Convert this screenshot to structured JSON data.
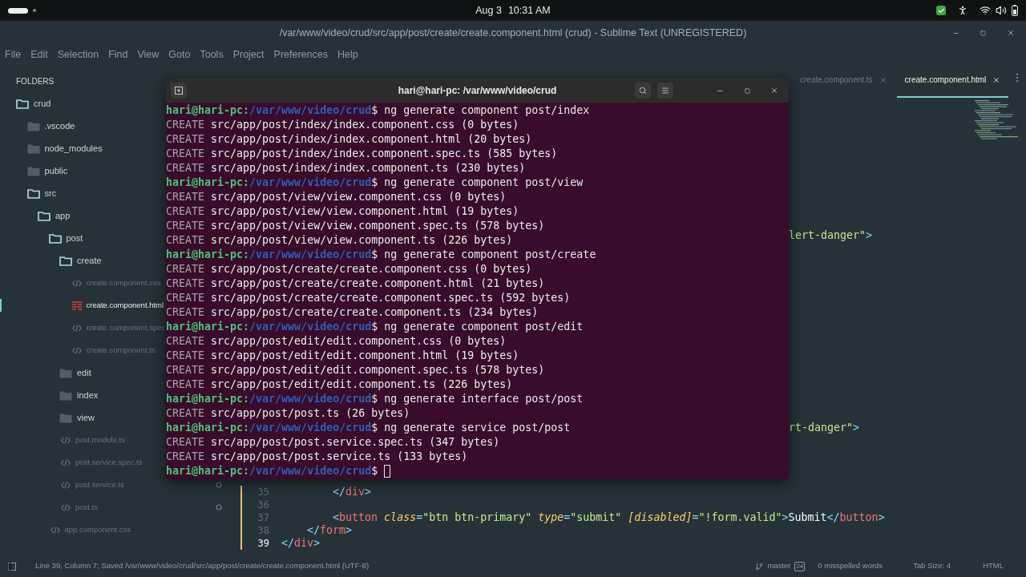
{
  "top_bar": {
    "date": "Aug 3",
    "time": "10:31 AM"
  },
  "window": {
    "title": "/var/www/video/crud/src/app/post/create/create.component.html (crud) - Sublime Text (UNREGISTERED)"
  },
  "menu": [
    "File",
    "Edit",
    "Selection",
    "Find",
    "View",
    "Goto",
    "Tools",
    "Project",
    "Preferences",
    "Help"
  ],
  "sidebar": {
    "header": "FOLDERS",
    "items": [
      {
        "label": "crud",
        "kind": "folder",
        "expanded": true,
        "children": [
          {
            "label": ".vscode",
            "kind": "folder",
            "expanded": false
          },
          {
            "label": "node_modules",
            "kind": "folder",
            "expanded": false
          },
          {
            "label": "public",
            "kind": "folder",
            "expanded": false
          },
          {
            "label": "src",
            "kind": "folder",
            "expanded": true,
            "children": [
              {
                "label": "app",
                "kind": "folder",
                "expanded": true,
                "children": [
                  {
                    "label": "post",
                    "kind": "folder",
                    "expanded": true,
                    "children": [
                      {
                        "label": "create",
                        "kind": "folder",
                        "expanded": true,
                        "children": [
                          {
                            "label": "create.component.css",
                            "kind": "file",
                            "selected": false
                          },
                          {
                            "label": "create.component.html",
                            "kind": "file",
                            "selected": true
                          },
                          {
                            "label": "create.component.spec",
                            "kind": "file",
                            "selected": false
                          },
                          {
                            "label": "create.component.ts",
                            "kind": "file",
                            "selected": false
                          }
                        ]
                      },
                      {
                        "label": "edit",
                        "kind": "folder",
                        "expanded": false
                      },
                      {
                        "label": "index",
                        "kind": "folder",
                        "expanded": false
                      },
                      {
                        "label": "view",
                        "kind": "folder",
                        "expanded": false
                      },
                      {
                        "label": "post.module.ts",
                        "kind": "file",
                        "selected": false
                      },
                      {
                        "label": "post.service.spec.ts",
                        "kind": "file",
                        "selected": false
                      },
                      {
                        "label": "post.service.ts",
                        "kind": "file",
                        "selected": false,
                        "modified": true
                      },
                      {
                        "label": "post.ts",
                        "kind": "file",
                        "selected": false,
                        "modified": true
                      }
                    ]
                  },
                  {
                    "label": "app.component.css",
                    "kind": "file",
                    "selected": false
                  }
                ]
              }
            ]
          }
        ]
      }
    ]
  },
  "tabs": [
    {
      "label": "create.component.ts",
      "selected": false
    },
    {
      "label": "create.component.html",
      "selected": true
    }
  ],
  "editor": {
    "fragments": [
      [
        {
          "kind": "string",
          "text": "lert-danger\""
        },
        {
          "kind": "punct",
          "text": ">"
        }
      ],
      [
        {
          "kind": "string",
          "text": "rt-danger\""
        },
        {
          "kind": "punct",
          "text": ">"
        }
      ]
    ],
    "lines": [
      {
        "number": "35",
        "current": false,
        "tokens": [
          {
            "kind": "punct",
            "text": "        </"
          },
          {
            "kind": "tag",
            "text": "div"
          },
          {
            "kind": "punct",
            "text": ">"
          }
        ]
      },
      {
        "number": "36",
        "current": false
      },
      {
        "number": "37",
        "current": false,
        "tokens": [
          {
            "kind": "punct",
            "text": "        <"
          },
          {
            "kind": "tag",
            "text": "button"
          },
          {
            "kind": "attr",
            "text": " class"
          },
          {
            "kind": "punct",
            "text": "="
          },
          {
            "kind": "string",
            "text": "\"btn btn-primary\""
          },
          {
            "kind": "attr",
            "text": " type"
          },
          {
            "kind": "punct",
            "text": "="
          },
          {
            "kind": "string",
            "text": "\"submit\""
          },
          {
            "kind": "attr",
            "text": " [disabled]"
          },
          {
            "kind": "punct",
            "text": "="
          },
          {
            "kind": "string",
            "text": "\"!form.valid\""
          },
          {
            "kind": "punct",
            "text": ">"
          },
          {
            "kind": "text",
            "text": "Submit"
          },
          {
            "kind": "punct",
            "text": "</"
          },
          {
            "kind": "tag",
            "text": "button"
          },
          {
            "kind": "punct",
            "text": ">"
          }
        ]
      },
      {
        "number": "38",
        "current": false,
        "tokens": [
          {
            "kind": "punct",
            "text": "    </"
          },
          {
            "kind": "tag",
            "text": "form"
          },
          {
            "kind": "punct",
            "text": ">"
          }
        ]
      },
      {
        "number": "39",
        "current": true,
        "tokens": [
          {
            "kind": "punct",
            "text": "</"
          },
          {
            "kind": "tag",
            "text": "div"
          },
          {
            "kind": "punct",
            "text": ">"
          }
        ]
      }
    ]
  },
  "status_bar": {
    "position": "Line 39, Column 7; Saved /var/www/video/crud/src/app/post/create/create.component.html (UTF-8)",
    "branch": "master",
    "badge": "24",
    "spelling": "0 misspelled words",
    "tab_size": "Tab Size: 4",
    "syntax": "HTML"
  },
  "terminal": {
    "title": "hari@hari-pc: /var/www/video/crud",
    "lines": [
      {
        "kind": "prompt",
        "user": "hari@hari-pc:",
        "path": "/var/www/video/crud",
        "symbol": "$",
        "command": "ng generate component post/index",
        "cursor": false
      },
      {
        "kind": "output",
        "label": "CREATE",
        "text": "src/app/post/index/index.component.css (0 bytes)"
      },
      {
        "kind": "output",
        "label": "CREATE",
        "text": "src/app/post/index/index.component.html (20 bytes)"
      },
      {
        "kind": "output",
        "label": "CREATE",
        "text": "src/app/post/index/index.component.spec.ts (585 bytes)"
      },
      {
        "kind": "output",
        "label": "CREATE",
        "text": "src/app/post/index/index.component.ts (230 bytes)"
      },
      {
        "kind": "prompt",
        "user": "hari@hari-pc:",
        "path": "/var/www/video/crud",
        "symbol": "$",
        "command": "ng generate component post/view",
        "cursor": false
      },
      {
        "kind": "output",
        "label": "CREATE",
        "text": "src/app/post/view/view.component.css (0 bytes)"
      },
      {
        "kind": "output",
        "label": "CREATE",
        "text": "src/app/post/view/view.component.html (19 bytes)"
      },
      {
        "kind": "output",
        "label": "CREATE",
        "text": "src/app/post/view/view.component.spec.ts (578 bytes)"
      },
      {
        "kind": "output",
        "label": "CREATE",
        "text": "src/app/post/view/view.component.ts (226 bytes)"
      },
      {
        "kind": "prompt",
        "user": "hari@hari-pc:",
        "path": "/var/www/video/crud",
        "symbol": "$",
        "command": "ng generate component post/create",
        "cursor": false
      },
      {
        "kind": "output",
        "label": "CREATE",
        "text": "src/app/post/create/create.component.css (0 bytes)"
      },
      {
        "kind": "output",
        "label": "CREATE",
        "text": "src/app/post/create/create.component.html (21 bytes)"
      },
      {
        "kind": "output",
        "label": "CREATE",
        "text": "src/app/post/create/create.component.spec.ts (592 bytes)"
      },
      {
        "kind": "output",
        "label": "CREATE",
        "text": "src/app/post/create/create.component.ts (234 bytes)"
      },
      {
        "kind": "prompt",
        "user": "hari@hari-pc:",
        "path": "/var/www/video/crud",
        "symbol": "$",
        "command": "ng generate component post/edit",
        "cursor": false
      },
      {
        "kind": "output",
        "label": "CREATE",
        "text": "src/app/post/edit/edit.component.css (0 bytes)"
      },
      {
        "kind": "output",
        "label": "CREATE",
        "text": "src/app/post/edit/edit.component.html (19 bytes)"
      },
      {
        "kind": "output",
        "label": "CREATE",
        "text": "src/app/post/edit/edit.component.spec.ts (578 bytes)"
      },
      {
        "kind": "output",
        "label": "CREATE",
        "text": "src/app/post/edit/edit.component.ts (226 bytes)"
      },
      {
        "kind": "prompt",
        "user": "hari@hari-pc:",
        "path": "/var/www/video/crud",
        "symbol": "$",
        "command": "ng generate interface post/post",
        "cursor": false
      },
      {
        "kind": "output",
        "label": "CREATE",
        "text": "src/app/post/post.ts (26 bytes)"
      },
      {
        "kind": "prompt",
        "user": "hari@hari-pc:",
        "path": "/var/www/video/crud",
        "symbol": "$",
        "command": "ng generate service post/post",
        "cursor": false
      },
      {
        "kind": "output",
        "label": "CREATE",
        "text": "src/app/post/post.service.spec.ts (347 bytes)"
      },
      {
        "kind": "output",
        "label": "CREATE",
        "text": "src/app/post/post.service.ts (133 bytes)"
      },
      {
        "kind": "prompt",
        "user": "hari@hari-pc:",
        "path": "/var/www/video/crud",
        "symbol": "$",
        "cursor": true
      }
    ]
  }
}
